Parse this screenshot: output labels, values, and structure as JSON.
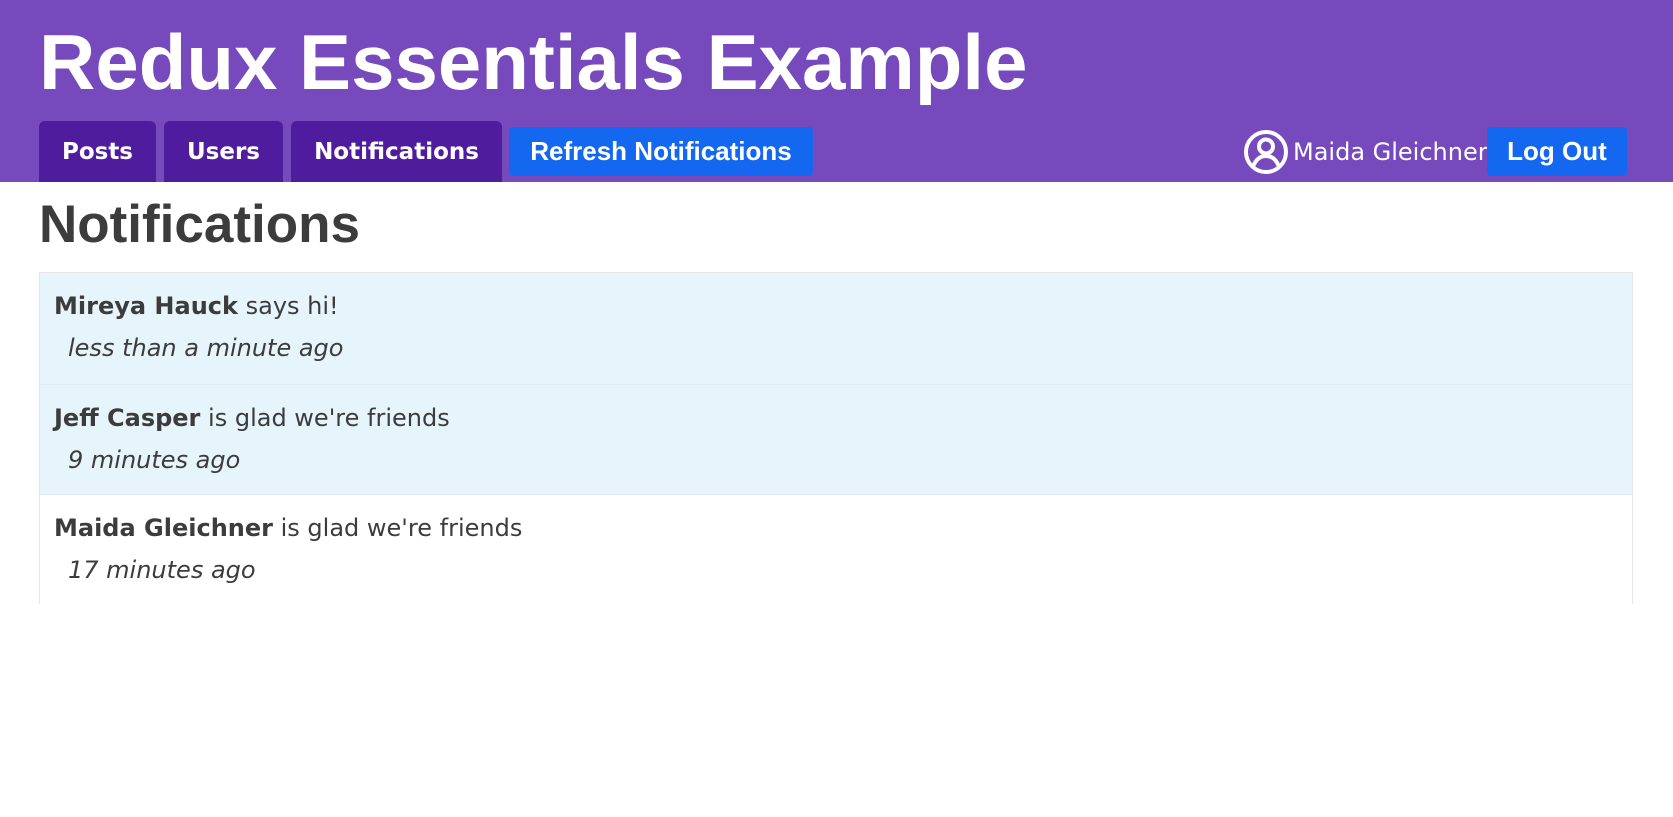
{
  "app": {
    "title": "Redux Essentials Example"
  },
  "nav": {
    "tabs": [
      {
        "label": "Posts"
      },
      {
        "label": "Users"
      },
      {
        "label": "Notifications"
      }
    ],
    "refresh_label": "Refresh Notifications"
  },
  "user": {
    "icon": "user-circle-icon",
    "name": "Maida Gleichner",
    "logout_label": "Log Out"
  },
  "page": {
    "title": "Notifications"
  },
  "notifications": [
    {
      "author": "Mireya Hauck",
      "message": "says hi!",
      "time": "less than a minute ago",
      "unread": true
    },
    {
      "author": "Jeff Casper",
      "message": "is glad we're friends",
      "time": "9 minutes ago",
      "unread": true
    },
    {
      "author": "Maida Gleichner",
      "message": "is glad we're friends",
      "time": "17 minutes ago",
      "unread": false
    }
  ],
  "colors": {
    "header_bg": "#764abc",
    "tab_bg": "#4e1c9c",
    "button_bg": "#1468f0",
    "unread_bg": "#e6f4fc",
    "text": "#3c3c3c"
  }
}
